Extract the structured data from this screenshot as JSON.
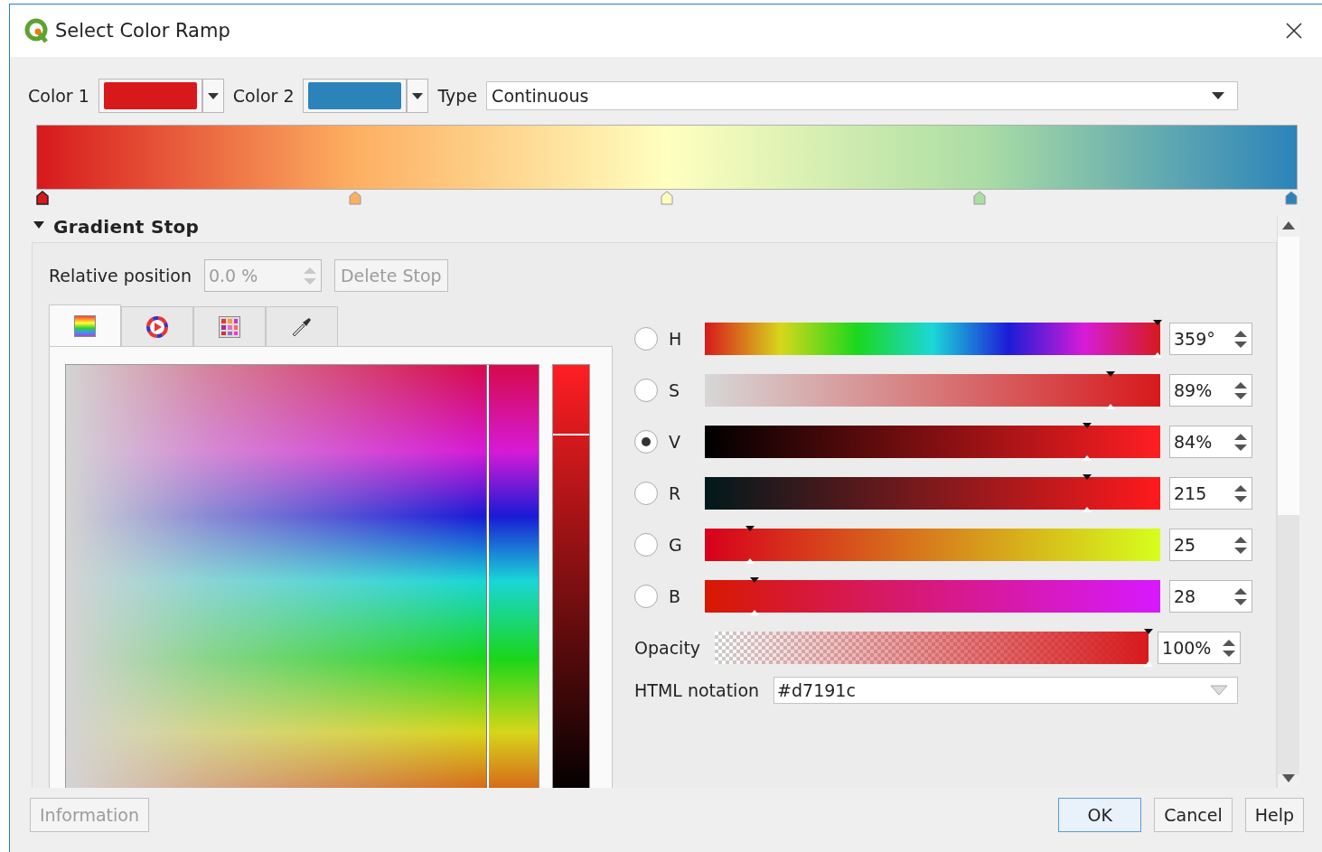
{
  "window": {
    "title": "Select Color Ramp"
  },
  "color1": {
    "label": "Color 1",
    "color": "#d7191c"
  },
  "color2": {
    "label": "Color 2",
    "color": "#2b83ba"
  },
  "type": {
    "label": "Type",
    "value": "Continuous"
  },
  "ramp": {
    "stops": [
      {
        "color": "#d7191c",
        "selected": true
      },
      {
        "color": "#fdae61",
        "selected": false
      },
      {
        "color": "#ffffbf",
        "selected": false
      },
      {
        "color": "#abdda4",
        "selected": false
      },
      {
        "color": "#2b83ba",
        "selected": false
      }
    ]
  },
  "gradient_stop": {
    "title": "Gradient Stop",
    "expanded": true,
    "relative_position": {
      "label": "Relative position",
      "value": "0.0 %",
      "disabled": true
    },
    "delete_button": {
      "label": "Delete Stop",
      "disabled": true
    },
    "tabs": [
      {
        "kind": "ramp",
        "selected": true
      },
      {
        "kind": "wheel",
        "selected": false
      },
      {
        "kind": "swatches",
        "selected": false
      },
      {
        "kind": "picker",
        "selected": false
      }
    ],
    "channels": [
      {
        "kind": "hue",
        "label": "H",
        "selected": false,
        "level": 0.995,
        "value": "359°"
      },
      {
        "kind": "saturation",
        "label": "S",
        "selected": false,
        "level": 0.89,
        "value": "89%"
      },
      {
        "kind": "value",
        "label": "V",
        "selected": true,
        "level": 0.84,
        "value": "84%"
      },
      {
        "kind": "red",
        "label": "R",
        "selected": false,
        "level": 0.84,
        "value": "215"
      },
      {
        "kind": "green",
        "label": "G",
        "selected": false,
        "level": 0.1,
        "value": "25"
      },
      {
        "kind": "blue",
        "label": "B",
        "selected": false,
        "level": 0.11,
        "value": "28"
      }
    ],
    "opacity": {
      "label": "Opacity",
      "level": 1,
      "value": "100%"
    },
    "html_notation": {
      "label": "HTML notation",
      "value": "#d7191c"
    }
  },
  "buttons": [
    {
      "label": "Information",
      "disabled": true,
      "default": false
    },
    {
      "label": "OK",
      "disabled": false,
      "default": true
    },
    {
      "label": "Cancel",
      "disabled": false,
      "default": false
    },
    {
      "label": "Help",
      "disabled": false,
      "default": false
    }
  ]
}
